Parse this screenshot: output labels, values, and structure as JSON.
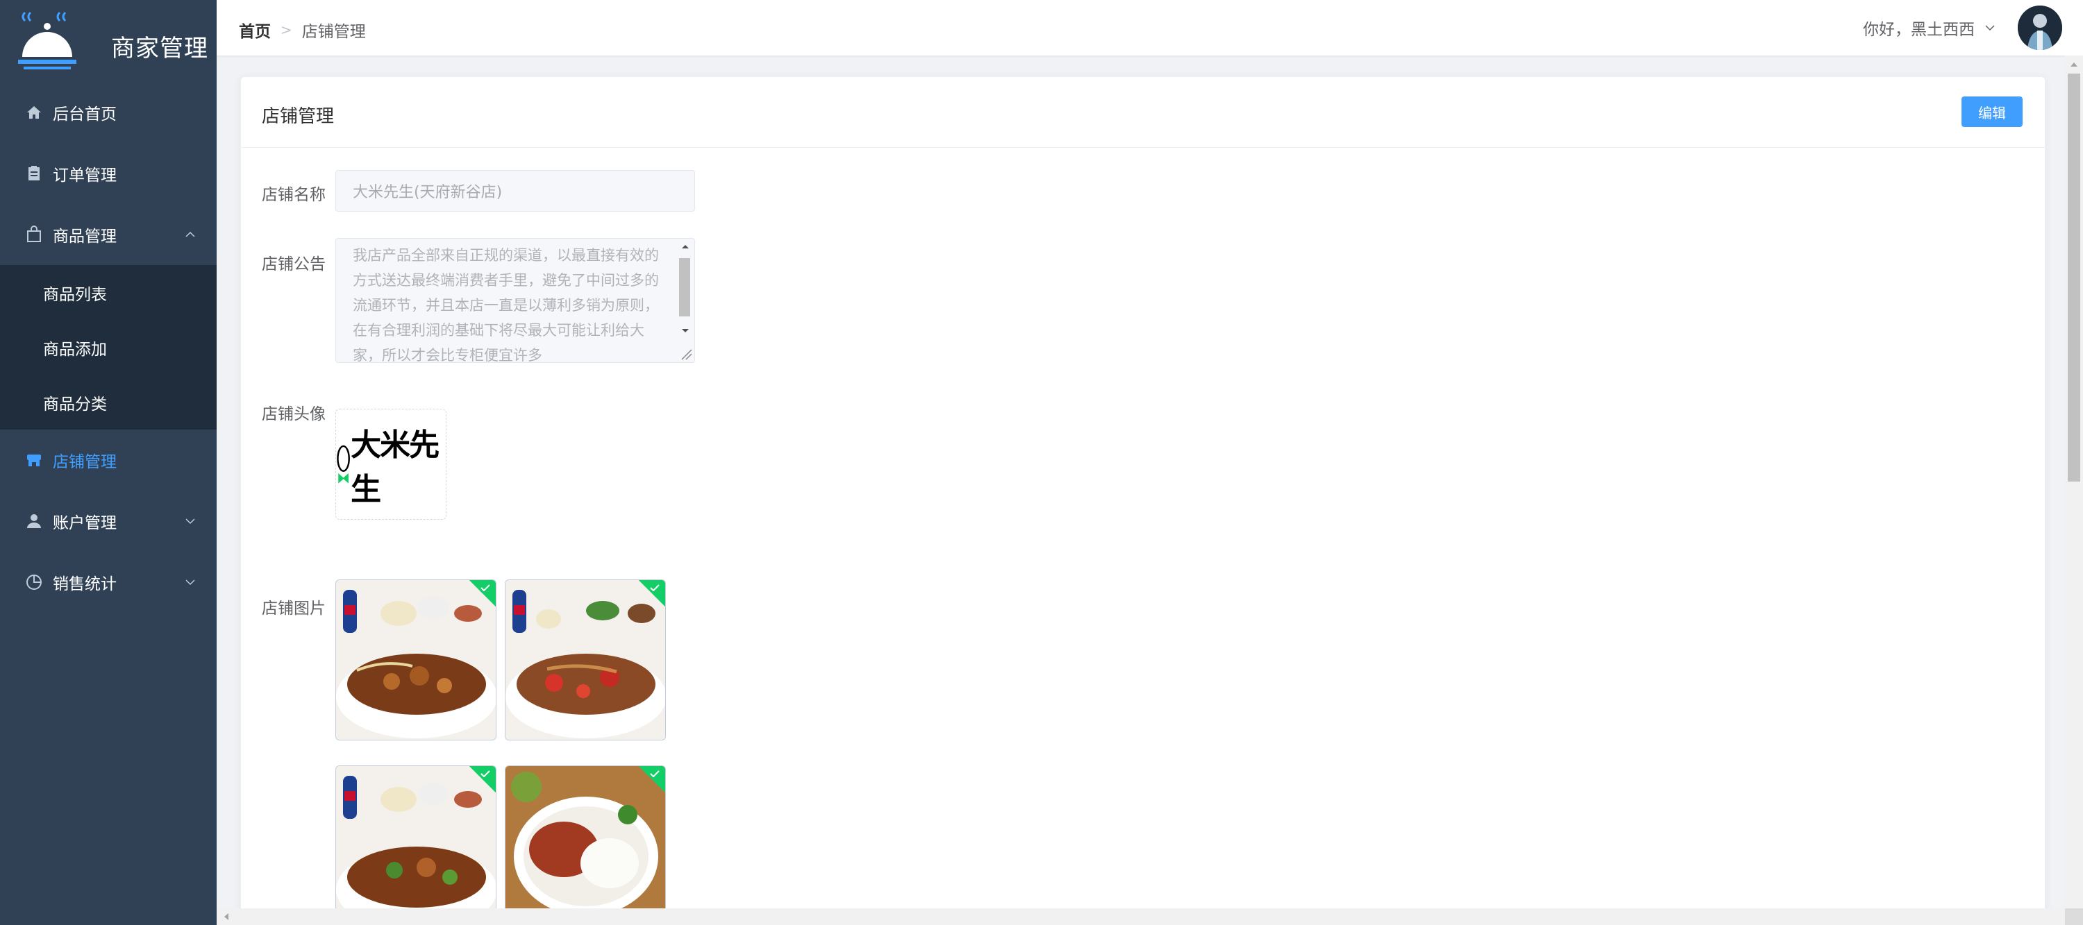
{
  "app": {
    "title": "商家管理"
  },
  "sidebar": {
    "items": [
      {
        "label": "后台首页",
        "icon": "home-icon"
      },
      {
        "label": "订单管理",
        "icon": "clipboard-icon"
      },
      {
        "label": "商品管理",
        "icon": "bag-icon",
        "expanded": true,
        "children": [
          {
            "label": "商品列表"
          },
          {
            "label": "商品添加"
          },
          {
            "label": "商品分类"
          }
        ]
      },
      {
        "label": "店铺管理",
        "icon": "shop-icon",
        "active": true
      },
      {
        "label": "账户管理",
        "icon": "user-icon"
      },
      {
        "label": "销售统计",
        "icon": "pie-chart-icon"
      }
    ]
  },
  "header": {
    "breadcrumb": [
      "首页",
      "店铺管理"
    ],
    "greeting": "你好，黑土西西"
  },
  "card": {
    "title": "店铺管理",
    "edit_label": "编辑"
  },
  "form": {
    "name_label": "店铺名称",
    "name_value": "大米先生(天府新谷店)",
    "notice_label": "店铺公告",
    "notice_value": "我店产品全部来自正规的渠道，以最直接有效的方式送达最终端消费者手里，避免了中间过多的流通环节，并且本店一直是以薄利多销为原则，在有合理利润的基础下将尽最大可能让利给大家，所以才会比专柜便宜许多",
    "avatar_label": "店铺头像",
    "avatar_logo_text": "大米先生",
    "pics_label": "店铺图片"
  },
  "colors": {
    "sidebar_bg": "#304156",
    "submenu_bg": "#1f2d3d",
    "accent": "#409eff",
    "success": "#13ce66"
  }
}
